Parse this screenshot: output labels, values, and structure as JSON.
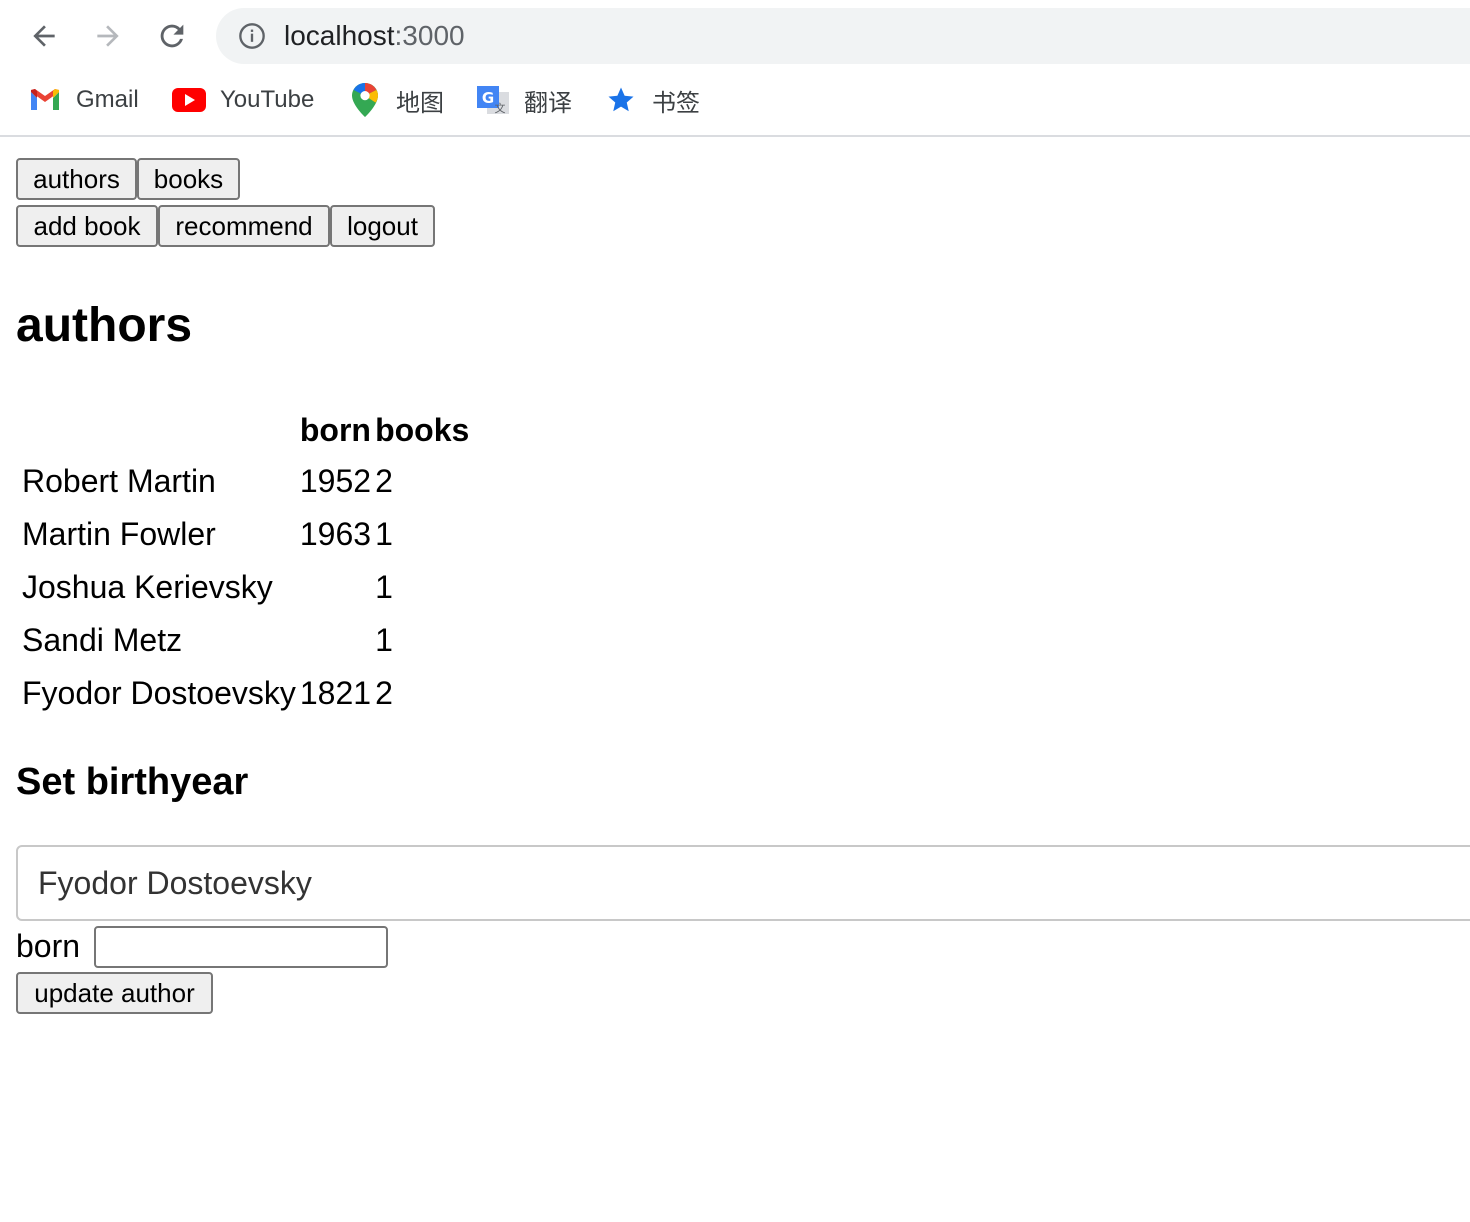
{
  "browser": {
    "url_host": "localhost",
    "url_port": ":3000",
    "bookmarks": [
      {
        "label": "Gmail",
        "icon": "gmail-icon"
      },
      {
        "label": "YouTube",
        "icon": "youtube-icon"
      },
      {
        "label": "地图",
        "icon": "maps-pin-icon"
      },
      {
        "label": "翻译",
        "icon": "translate-icon"
      },
      {
        "label": "书签",
        "icon": "star-icon"
      }
    ]
  },
  "nav": {
    "row1": [
      "authors",
      "books"
    ],
    "row2": [
      "add book",
      "recommend",
      "logout"
    ]
  },
  "page": {
    "title": "authors",
    "table": {
      "headers": [
        "",
        "born",
        "books"
      ],
      "rows": [
        {
          "name": "Robert Martin",
          "born": "1952",
          "books": "2"
        },
        {
          "name": "Martin Fowler",
          "born": "1963",
          "books": "1"
        },
        {
          "name": "Joshua Kerievsky",
          "born": "",
          "books": "1"
        },
        {
          "name": "Sandi Metz",
          "born": "",
          "books": "1"
        },
        {
          "name": "Fyodor Dostoevsky",
          "born": "1821",
          "books": "2"
        }
      ]
    },
    "form": {
      "heading": "Set birthyear",
      "selected_author": "Fyodor Dostoevsky",
      "born_label": "born",
      "born_value": "",
      "submit_label": "update author"
    }
  }
}
